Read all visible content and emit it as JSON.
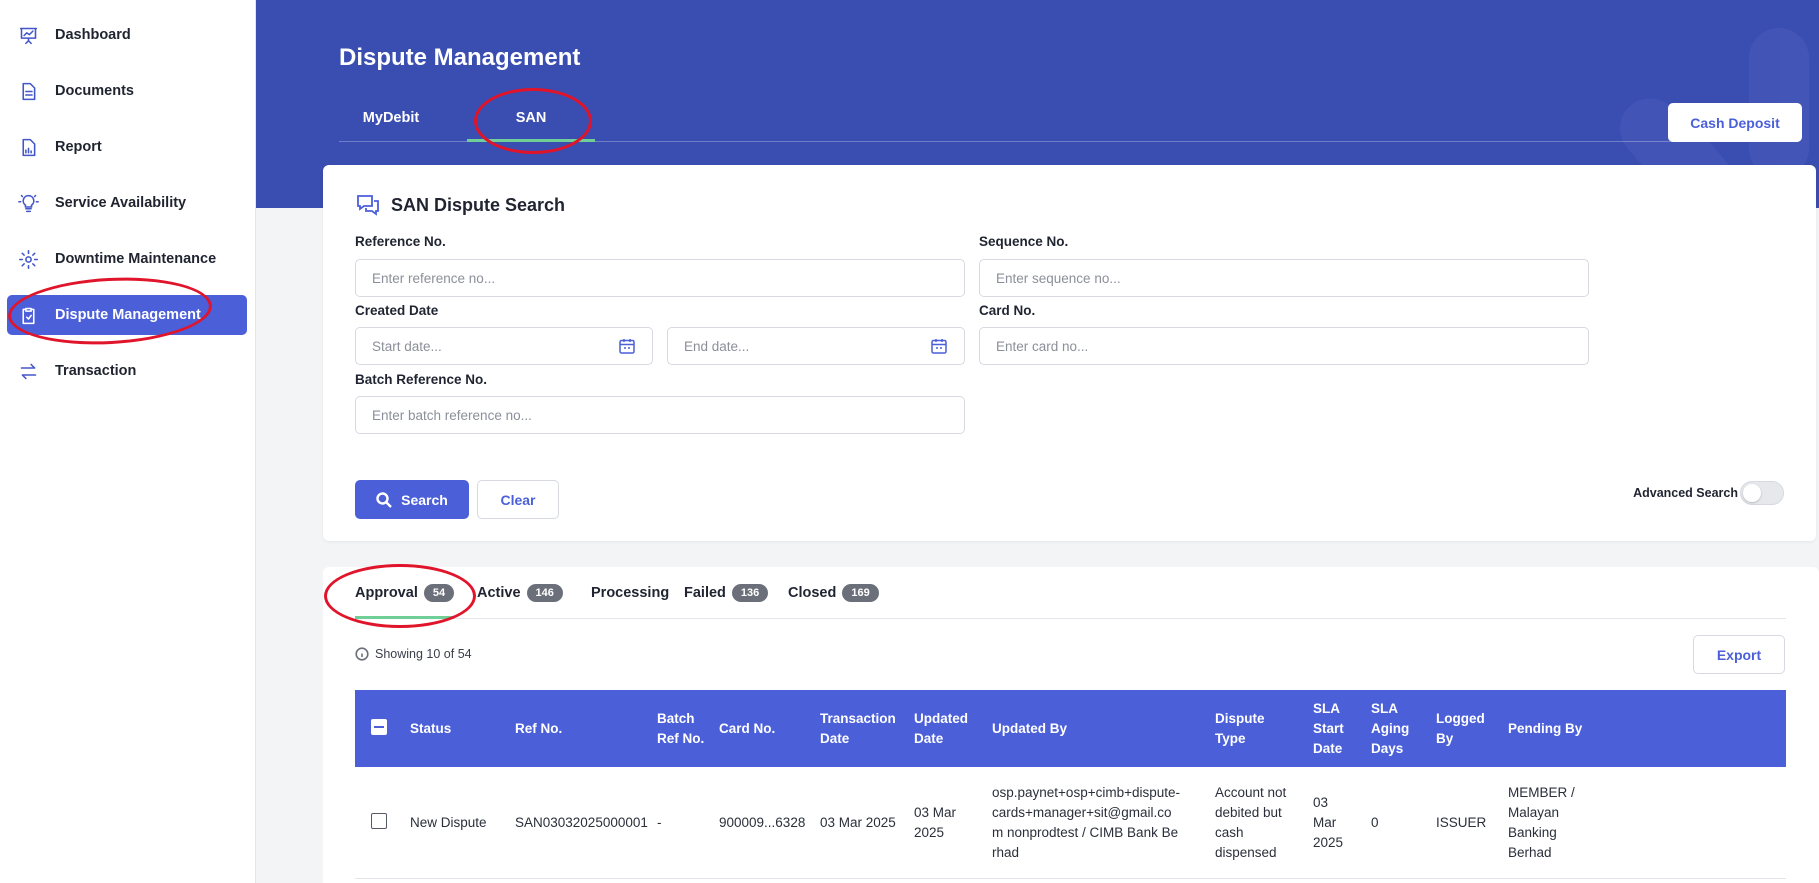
{
  "sidebar": {
    "items": [
      {
        "label": "Dashboard",
        "icon": "chart-icon"
      },
      {
        "label": "Documents",
        "icon": "document-icon"
      },
      {
        "label": "Report",
        "icon": "report-icon"
      },
      {
        "label": "Service Availability",
        "icon": "lightbulb-icon"
      },
      {
        "label": "Downtime Maintenance",
        "icon": "gear-icon"
      },
      {
        "label": "Dispute Management",
        "icon": "clipboard-icon",
        "active": true
      },
      {
        "label": "Transaction",
        "icon": "transfer-icon"
      }
    ]
  },
  "header": {
    "title": "Dispute Management",
    "tabs": [
      {
        "label": "MyDebit"
      },
      {
        "label": "SAN",
        "active": true
      }
    ],
    "cash_deposit_label": "Cash Deposit"
  },
  "search": {
    "title": "SAN Dispute Search",
    "reference_label": "Reference No.",
    "reference_placeholder": "Enter reference no...",
    "sequence_label": "Sequence No.",
    "sequence_placeholder": "Enter sequence no...",
    "created_date_label": "Created Date",
    "start_date_placeholder": "Start date...",
    "end_date_placeholder": "End date...",
    "card_label": "Card No.",
    "card_placeholder": "Enter card no...",
    "batch_label": "Batch Reference No.",
    "batch_placeholder": "Enter batch reference no...",
    "search_label": "Search",
    "clear_label": "Clear",
    "advanced_label": "Advanced Search"
  },
  "results": {
    "tabs": [
      {
        "label": "Approval",
        "count": "54",
        "active": true
      },
      {
        "label": "Active",
        "count": "146"
      },
      {
        "label": "Processing",
        "count": ""
      },
      {
        "label": "Failed",
        "count": "136"
      },
      {
        "label": "Closed",
        "count": "169"
      }
    ],
    "showing_text": "Showing 10 of 54",
    "export_label": "Export",
    "columns": [
      "Status",
      "Ref No.",
      "Batch Ref No.",
      "Card No.",
      "Transaction Date",
      "Updated Date",
      "Updated By",
      "Dispute Type",
      "SLA Start Date",
      "SLA Aging Days",
      "Logged By",
      "Pending By"
    ],
    "rows": [
      {
        "status": "New Dispute",
        "ref_no": "SAN03032025000001",
        "batch_ref_no": "-",
        "card_no": "900009...6328",
        "transaction_date": "03 Mar 2025",
        "updated_date": "03 Mar 2025",
        "updated_by": "osp.paynet+osp+cimb+dispute-cards+manager+sit@gmail.com nonprodtest / CIMB Bank Berhad",
        "dispute_type": "Account not debited but cash dispensed",
        "sla_start_date": "03 Mar 2025",
        "sla_aging_days": "0",
        "logged_by": "ISSUER",
        "pending_by": "MEMBER / Malayan Banking Berhad"
      }
    ]
  },
  "colors": {
    "primary": "#4b5fd9",
    "header_band": "#3a4db0",
    "active_underline": "#6fcf97",
    "annotation": "#e0142a"
  }
}
